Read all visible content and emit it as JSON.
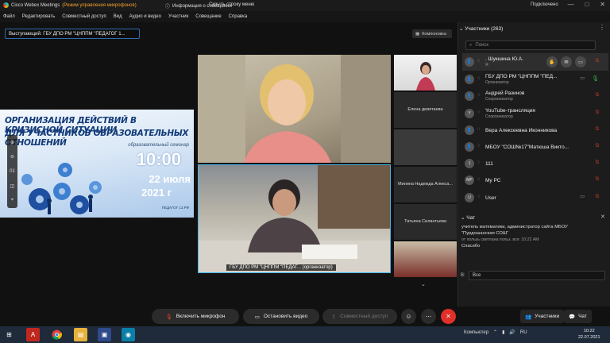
{
  "window": {
    "app_name": "Cisco Webex Meetings",
    "mic_hint": "(Режим управления микрофонов)",
    "meeting_info": "Информация о совещании",
    "hide_menu": "Скрыть строку меню",
    "connection": "Подключено",
    "controls": [
      "—",
      "□",
      "✕"
    ]
  },
  "menu": [
    "Файл",
    "Редактировать",
    "Совместный доступ",
    "Вид",
    "Аудио и видео",
    "Участник",
    "Совещание",
    "Справка"
  ],
  "speaker_label": "Выступающий: ГБУ ДПО РМ \"ЦНППМ \"ПЕДАГОГ 1...",
  "layout_button": "Компоновка",
  "slide": {
    "title_line1": "ОРГАНИЗАЦИЯ ДЕЙСТВИЙ В КРИЗИСНОЙ СИТУАЦИИ",
    "title_line2": "ДЛЯ УЧАСТНИКОВ ОБРАЗОВАТЕЛЬНЫХ ОТНОШЕНИЙ",
    "subtitle": "образовательный семинар",
    "time": "10:00",
    "date_line1": "22 июля",
    "date_line2": "2021 г",
    "org": "ПЕДАГОГ 13.РФ"
  },
  "slide_tools": [
    "⊕",
    "⊖",
    "01",
    "◫",
    "⌖"
  ],
  "videos": {
    "bottom_name": "ГБУ ДПО РМ \"ЦНППМ \"ПЕДАГ... (организатор)"
  },
  "thumbnails": [
    {
      "label": ""
    },
    {
      "label": "Елена девятаева"
    },
    {
      "label": ""
    },
    {
      "label": "Минина Надежда Алекса..."
    },
    {
      "label": "Татьяна Силантьева"
    },
    {
      "label": ""
    }
  ],
  "participants_panel": {
    "title": "Участники (263)",
    "search_placeholder": "Поиск",
    "rows": [
      {
        "avatar": "👤",
        "name": ". Шукшина Ю.А.",
        "role": "Я",
        "mic": "off",
        "status": "",
        "cam": false
      },
      {
        "avatar": "👤",
        "name": "ГБУ ДПО РМ \"ЦНППМ \"ПЕД...",
        "role": "Организатор",
        "mic": "on",
        "status": "",
        "cam": true
      },
      {
        "avatar": "👤",
        "name": "Андрей Разинов",
        "role": "Соорганизатор",
        "mic": "off",
        "status": "",
        "cam": false
      },
      {
        "avatar": "Y",
        "name": "YouTube-трансляция",
        "role": "Соорганизатор",
        "mic": "off",
        "status": "",
        "cam": false
      },
      {
        "avatar": "👤",
        "name": "Вера Алексеевна Иконникова",
        "role": "",
        "mic": "off",
        "status": "",
        "cam": false
      },
      {
        "avatar": "👤",
        "name": "МБОУ \"СОШ№17\"Матюша Викто...",
        "role": "",
        "mic": "off",
        "status": "",
        "cam": false
      },
      {
        "avatar": "1",
        "name": "111",
        "role": "",
        "mic": "off",
        "status": "",
        "cam": false
      },
      {
        "avatar": "MP",
        "name": "My PC",
        "role": "",
        "mic": "off",
        "status": "",
        "cam": false
      },
      {
        "avatar": "U",
        "name": "User",
        "role": "",
        "mic": "off",
        "status": "",
        "cam": true
      }
    ]
  },
  "chat": {
    "title": "Чат",
    "message_line1": "учитель математики, администратор сайта МБОУ",
    "message_line2": "\"Пурдошанская СОШ\"",
    "meta": "от пользь светлана польз. все:    10:22 AM",
    "message2": "Спасибо",
    "to_label": "В:",
    "to_value": "Все"
  },
  "controls": {
    "mic_button": "Включить микрофон",
    "video_button": "Остановить видео",
    "share_button": "Совместный доступ",
    "participants_button": "Участники",
    "chat_button": "Чат"
  },
  "taskbar": {
    "computer": "Компьютер",
    "lang": "RU",
    "time": "10:22",
    "date": "22.07.2021"
  },
  "colors": {
    "accent_blue": "#46b4e6",
    "end_red": "#e0302a",
    "mic_muted": "#e0452b",
    "mic_on": "#3cb043"
  }
}
